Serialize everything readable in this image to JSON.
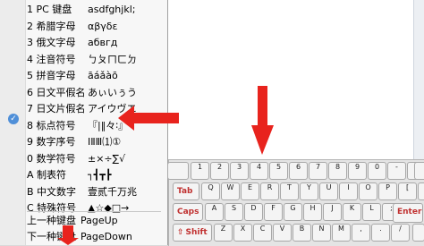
{
  "menu": {
    "items": [
      {
        "label": "1 PC 键盘",
        "sample": "asdfghjkl;"
      },
      {
        "label": "2 希腊字母",
        "sample": "αβγδε"
      },
      {
        "label": "3 俄文字母",
        "sample": "абвгд"
      },
      {
        "label": "4 注音符号",
        "sample": "ㄅㄆㄇㄈㄉ"
      },
      {
        "label": "5 拼音字母",
        "sample": "āáǎàō"
      },
      {
        "label": "6 日文平假名",
        "sample": "あぃいぅう"
      },
      {
        "label": "7 日文片假名",
        "sample": "アイウヴエ"
      },
      {
        "label": "8 标点符号",
        "sample": "『|‖々∶』"
      },
      {
        "label": "9 数字序号",
        "sample": "ⅠⅡⅢ⑴①"
      },
      {
        "label": "0 数学符号",
        "sample": "±×÷∑√"
      },
      {
        "label": "A 制表符",
        "sample": "┐┫┳┣"
      },
      {
        "label": "B 中文数字",
        "sample": "壹贰千万兆"
      },
      {
        "label": "C 特殊符号",
        "sample": "▲☆◆□→"
      }
    ],
    "selected_index": 7,
    "nav": [
      {
        "label": "上一种键盘",
        "shortcut": "PageUp"
      },
      {
        "label": "下一种键盘",
        "shortcut": "PageDown"
      }
    ],
    "check_icon": "checkmark-icon"
  },
  "keyboard": {
    "row1": [
      "1",
      "2",
      "3",
      "4",
      "5",
      "6",
      "7",
      "8",
      "9",
      "0",
      "-",
      "="
    ],
    "row2": [
      "Q",
      "W",
      "E",
      "R",
      "T",
      "Y",
      "U",
      "I",
      "O",
      "P",
      "[",
      "]"
    ],
    "row3": [
      "A",
      "S",
      "D",
      "F",
      "G",
      "H",
      "J",
      "K",
      "L",
      ";",
      "'"
    ],
    "row4": [
      "Z",
      "X",
      "C",
      "V",
      "B",
      "N",
      "M",
      ",",
      ".",
      "/"
    ],
    "tab_label": "Tab",
    "caps_label": "Caps",
    "shift_label": "Shift",
    "enter_label": "Enter",
    "shift_glyph": "⇧"
  },
  "colors": {
    "arrow": "#e8231d",
    "check": "#4f8fd8",
    "fn_key_text": "#c0302f"
  }
}
